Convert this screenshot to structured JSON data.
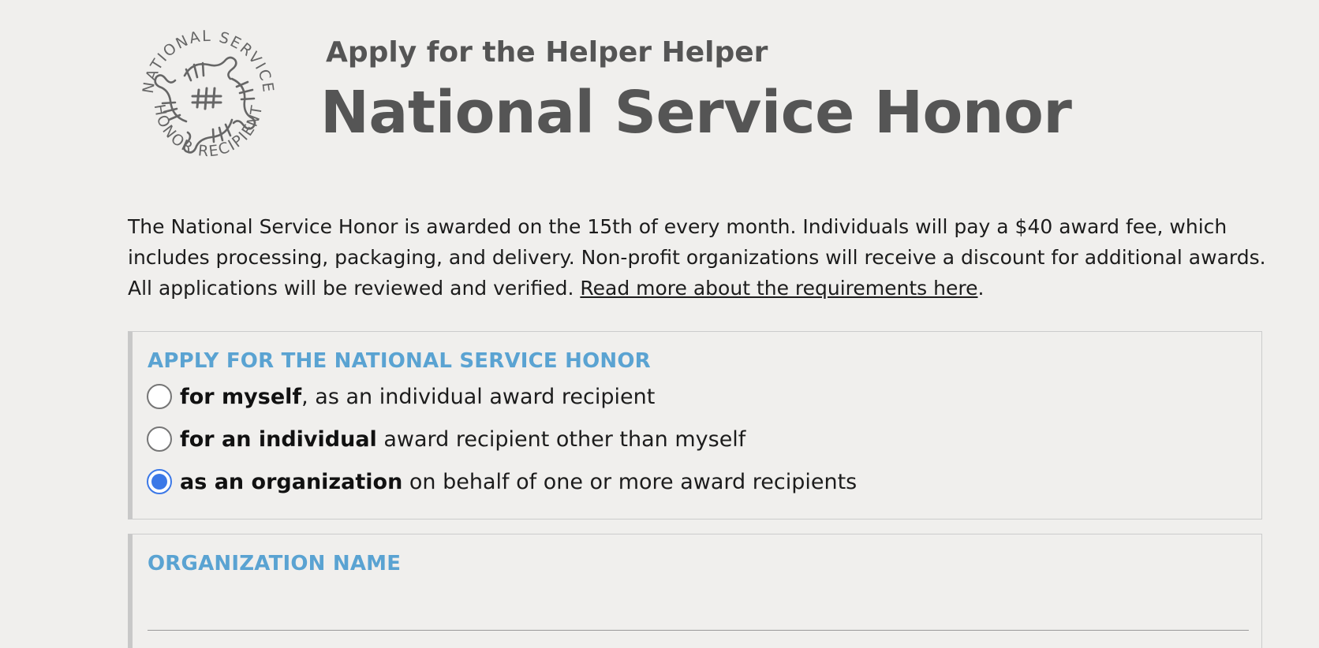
{
  "header": {
    "logo_icon": "national-service-honor-seal",
    "logo_text_top": "NATIONAL SERVICE",
    "logo_text_bottom": "HONOR RECIPIENT",
    "subtitle": "Apply for the Helper Helper",
    "title": "National Service Honor"
  },
  "intro": {
    "text": "The National Service Honor is awarded on the 15th of every month. Individuals will pay a $40 award fee, which includes processing, packaging, and delivery. Non-profit organizations will receive a discount for additional awards. All applications will be reviewed and verified. ",
    "link_text": "Read more about the requirements here",
    "trailing": "."
  },
  "apply_section": {
    "legend": "APPLY FOR THE NATIONAL SERVICE HONOR",
    "options": [
      {
        "bold": "for myself",
        "rest": ", as an individual award recipient",
        "checked": false
      },
      {
        "bold": "for an individual",
        "rest": " award recipient other than myself",
        "checked": false
      },
      {
        "bold": "as an organization",
        "rest": " on behalf of one or more award recipients",
        "checked": true
      }
    ]
  },
  "org_section": {
    "legend": "ORGANIZATION NAME",
    "value": ""
  },
  "colors": {
    "background": "#f0efed",
    "heading": "#555555",
    "legend": "#5aa3d2",
    "radio_checked": "#3b78e7"
  }
}
